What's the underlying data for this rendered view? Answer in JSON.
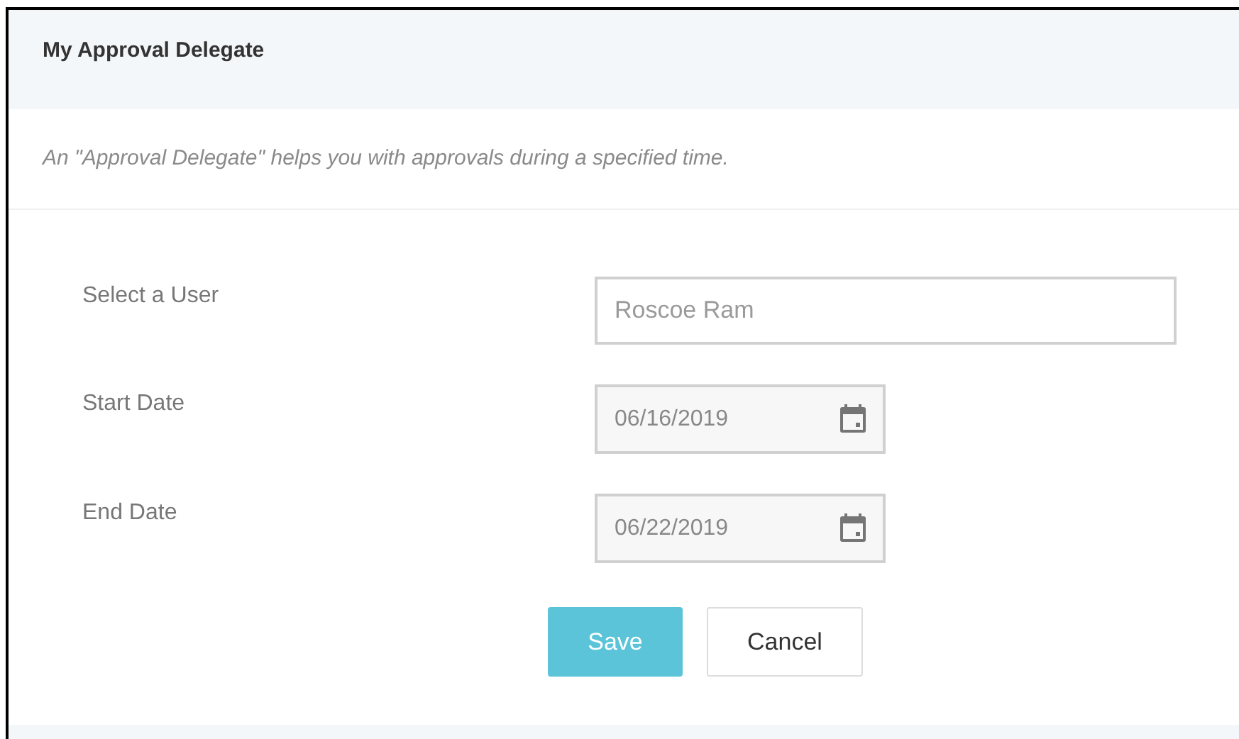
{
  "panel": {
    "title": "My Approval Delegate",
    "description": "An \"Approval Delegate\" helps you with approvals during a specified time."
  },
  "fields": [
    {
      "kind": "text",
      "label": "Select a User",
      "value": "Roscoe Ram"
    },
    {
      "kind": "date",
      "label": "Start Date",
      "value": "06/16/2019"
    },
    {
      "kind": "date",
      "label": "End Date",
      "value": "06/22/2019"
    }
  ],
  "buttons": [
    {
      "kind": "primary",
      "label": "Save"
    },
    {
      "kind": "secondary",
      "label": "Cancel"
    }
  ]
}
